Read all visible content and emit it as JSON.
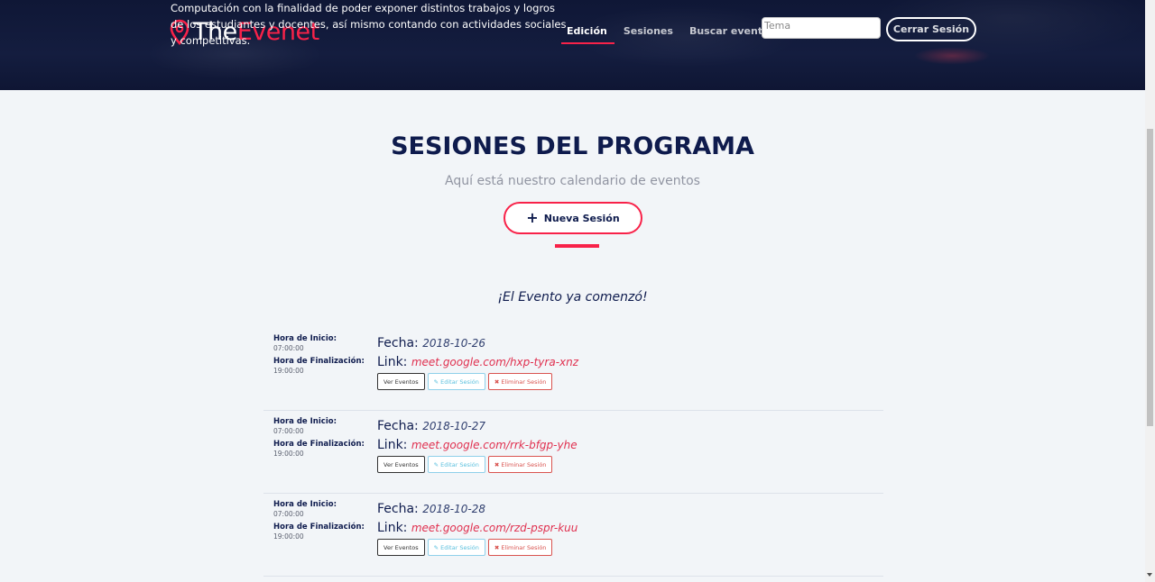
{
  "header": {
    "logo_prefix": "The",
    "logo_suffix": "Evenet",
    "intro_text": "Computación con la finalidad de poder exponer distintos trabajos y logros de los estudiantes y docentes, así mismo contando con actividades sociales y competitivas.",
    "nav": [
      {
        "label": "Edición",
        "active": true
      },
      {
        "label": "Sesiones",
        "active": false
      },
      {
        "label": "Buscar evento",
        "active": false
      }
    ],
    "search_placeholder": "Tema",
    "search_value": "",
    "logout_label": "Cerrar Sesión"
  },
  "main": {
    "title": "SESIONES DEL PROGRAMA",
    "subtitle": "Aquí está nuestro calendario de eventos",
    "new_session_icon": "+",
    "new_session_label": "Nueva Sesión",
    "status_message": "¡El Evento ya comenzó!"
  },
  "labels": {
    "start": "Hora de Inicio:",
    "end": "Hora de Finalización:",
    "date": "Fecha:",
    "link": "Link:",
    "view": "Ver Eventos",
    "edit": "Editar Sesión",
    "delete": "Eliminar Sesión"
  },
  "sessions": [
    {
      "start": "07:00:00",
      "end": "19:00:00",
      "date": "2018-10-26",
      "link": "meet.google.com/hxp-tyra-xnz"
    },
    {
      "start": "07:00:00",
      "end": "19:00:00",
      "date": "2018-10-27",
      "link": "meet.google.com/rrk-bfgp-yhe"
    },
    {
      "start": "07:00:00",
      "end": "19:00:00",
      "date": "2018-10-28",
      "link": "meet.google.com/rzd-pspr-kuu"
    }
  ],
  "icons": {
    "logo": "map-pin-icon",
    "plus": "plus-icon",
    "edit": "pencil-icon",
    "delete": "x-icon"
  },
  "colors": {
    "accent": "#f82249",
    "navy": "#0e1b4d",
    "header_bg": "#101838",
    "page_bg": "#f2f5f8"
  }
}
